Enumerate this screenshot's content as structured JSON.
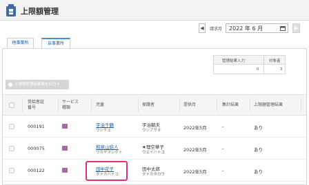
{
  "header": {
    "title": "上限額管理"
  },
  "month_bar": {
    "prev_glyph": "◀",
    "label": "請求月",
    "value": "2022 年 6 月",
    "next_glyph": "▶"
  },
  "tabs": [
    {
      "label": "他事業所"
    },
    {
      "label": "自事業所"
    }
  ],
  "summary": {
    "headers": [
      "管理結果入力",
      "対象者"
    ],
    "values": [
      "0",
      "3"
    ]
  },
  "export_button": {
    "label": "上限額管理結果票を出力 ▾"
  },
  "table": {
    "headers": {
      "id": "受給者証\n番号",
      "service": "サービス\n種類",
      "user": "児童",
      "guardian": "保護者",
      "month": "提供月",
      "sent": "集計結果",
      "result": "上限額管理結果"
    },
    "rows": [
      {
        "id": "000191",
        "name": "宇治千鶴",
        "kana": "ウジチエ",
        "guardian": "宇治朝夫",
        "guardian_kana": "ウジアサオ",
        "month": "2022年5月",
        "sent": "-",
        "result": "あり"
      },
      {
        "id": "000075",
        "name": "和泉山結人",
        "kana": "ワカヤマシゲト",
        "guardian": "★理空華子",
        "guardian_kana": "ウエイハナコ",
        "month": "2022年5月",
        "sent": "-",
        "result": "あり"
      },
      {
        "id": "000122",
        "name": "田中花子",
        "kana": "タナカハナコ",
        "guardian": "田中太郎",
        "guardian_kana": "タナカタロウ",
        "month": "2022年5月",
        "sent": "-",
        "result": "あり"
      }
    ]
  },
  "colors": {
    "accent": "#1a5ea8",
    "badge": "#a46aa8",
    "highlight": "#e0307a"
  }
}
